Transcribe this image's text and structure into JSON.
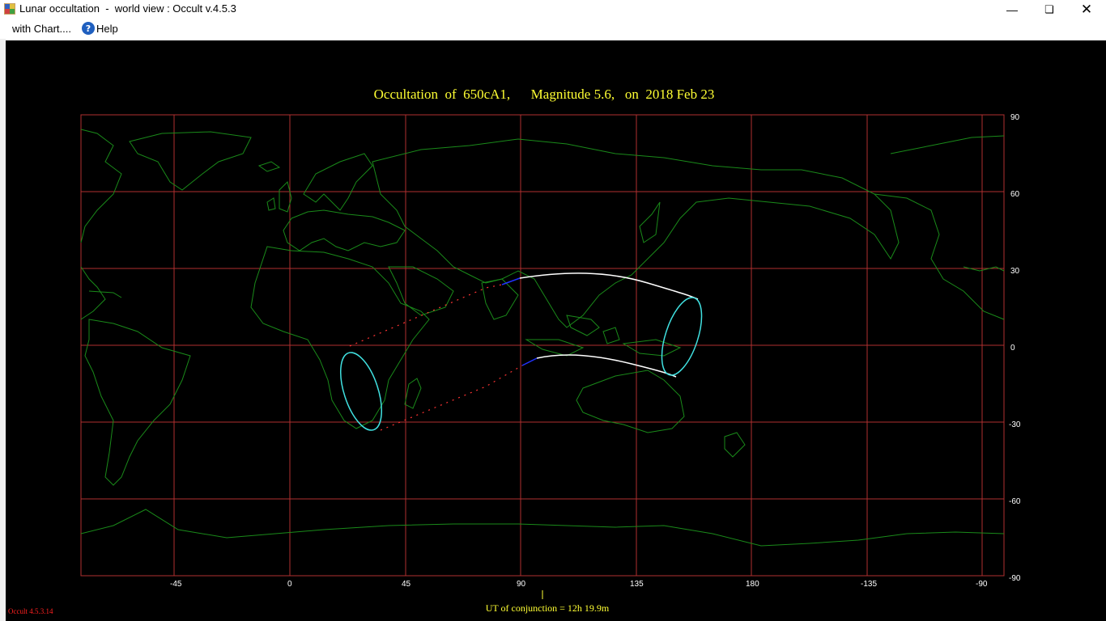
{
  "window": {
    "title": "Lunar occultation  -  world view : Occult v.4.5.3",
    "minimize_icon": "minimize-icon",
    "maximize_icon": "restore-icon",
    "close_icon": "close-icon"
  },
  "menu": {
    "items": [
      {
        "label": "with Chart...."
      },
      {
        "label": "Help",
        "icon": "help-icon"
      }
    ]
  },
  "plot": {
    "title": "Occultation  of  650cA1,      Magnitude 5.6,   on  2018 Feb 23",
    "x_ticks": [
      "-45",
      "0",
      "45",
      "90",
      "135",
      "180",
      "-135",
      "-90"
    ],
    "y_ticks": [
      "90",
      "60",
      "30",
      "0",
      "-30",
      "-60",
      "-90"
    ],
    "ut_label": "UT of conjunction = 12h 19.9m",
    "version": "Occult 4.5.3.14",
    "colors": {
      "background": "#000000",
      "grid": "#b03030",
      "coastline": "#1a8a1a",
      "path": "#ffffff",
      "limit_ellipse": "#40e0e0",
      "dotted_path": "#ff3333",
      "daylight_segment": "#2233ff",
      "title": "#ffff33"
    }
  }
}
